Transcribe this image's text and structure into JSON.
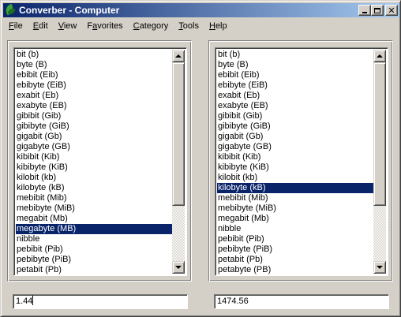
{
  "window": {
    "title": "Converber - Computer"
  },
  "menu": [
    {
      "pre": "",
      "ul": "F",
      "post": "ile"
    },
    {
      "pre": "",
      "ul": "E",
      "post": "dit"
    },
    {
      "pre": "",
      "ul": "V",
      "post": "iew"
    },
    {
      "pre": "F",
      "ul": "a",
      "post": "vorites"
    },
    {
      "pre": "",
      "ul": "C",
      "post": "ategory"
    },
    {
      "pre": "",
      "ul": "T",
      "post": "ools"
    },
    {
      "pre": "",
      "ul": "H",
      "post": "elp"
    }
  ],
  "left_list": {
    "items": [
      "bit (b)",
      "byte (B)",
      "ebibit (Eib)",
      "ebibyte (EiB)",
      "exabit (Eb)",
      "exabyte (EB)",
      "gibibit (Gib)",
      "gibibyte (GiB)",
      "gigabit (Gb)",
      "gigabyte (GB)",
      "kibibit (Kib)",
      "kibibyte (KiB)",
      "kilobit (kb)",
      "kilobyte (kB)",
      "mebibit (Mib)",
      "mebibyte (MiB)",
      "megabit (Mb)",
      "megabyte (MB)",
      "nibble",
      "pebibit (Pib)",
      "pebibyte (PiB)",
      "petabit (Pb)"
    ],
    "selected": "megabyte (MB)"
  },
  "right_list": {
    "items": [
      "bit (b)",
      "byte (B)",
      "ebibit (Eib)",
      "ebibyte (EiB)",
      "exabit (Eb)",
      "exabyte (EB)",
      "gibibit (Gib)",
      "gibibyte (GiB)",
      "gigabit (Gb)",
      "gigabyte (GB)",
      "kibibit (Kib)",
      "kibibyte (KiB)",
      "kilobit (kb)",
      "kilobyte (kB)",
      "mebibit (Mib)",
      "mebibyte (MiB)",
      "megabit (Mb)",
      "nibble",
      "pebibit (Pib)",
      "pebibyte (PiB)",
      "petabit (Pb)",
      "petabyte (PB)"
    ],
    "selected": "kilobyte (kB)"
  },
  "input_value": "1.44",
  "output_value": "1474.56",
  "icons": {
    "app": "green-leaf-icon",
    "minimize": "minimize-icon",
    "maximize": "maximize-icon",
    "close": "close-icon",
    "scroll_up": "arrow-up-icon",
    "scroll_down": "arrow-down-icon"
  },
  "colors": {
    "selection": "#0a246a",
    "titlebar_start": "#0a246a",
    "titlebar_end": "#a6caf0",
    "face": "#d4d0c8"
  }
}
